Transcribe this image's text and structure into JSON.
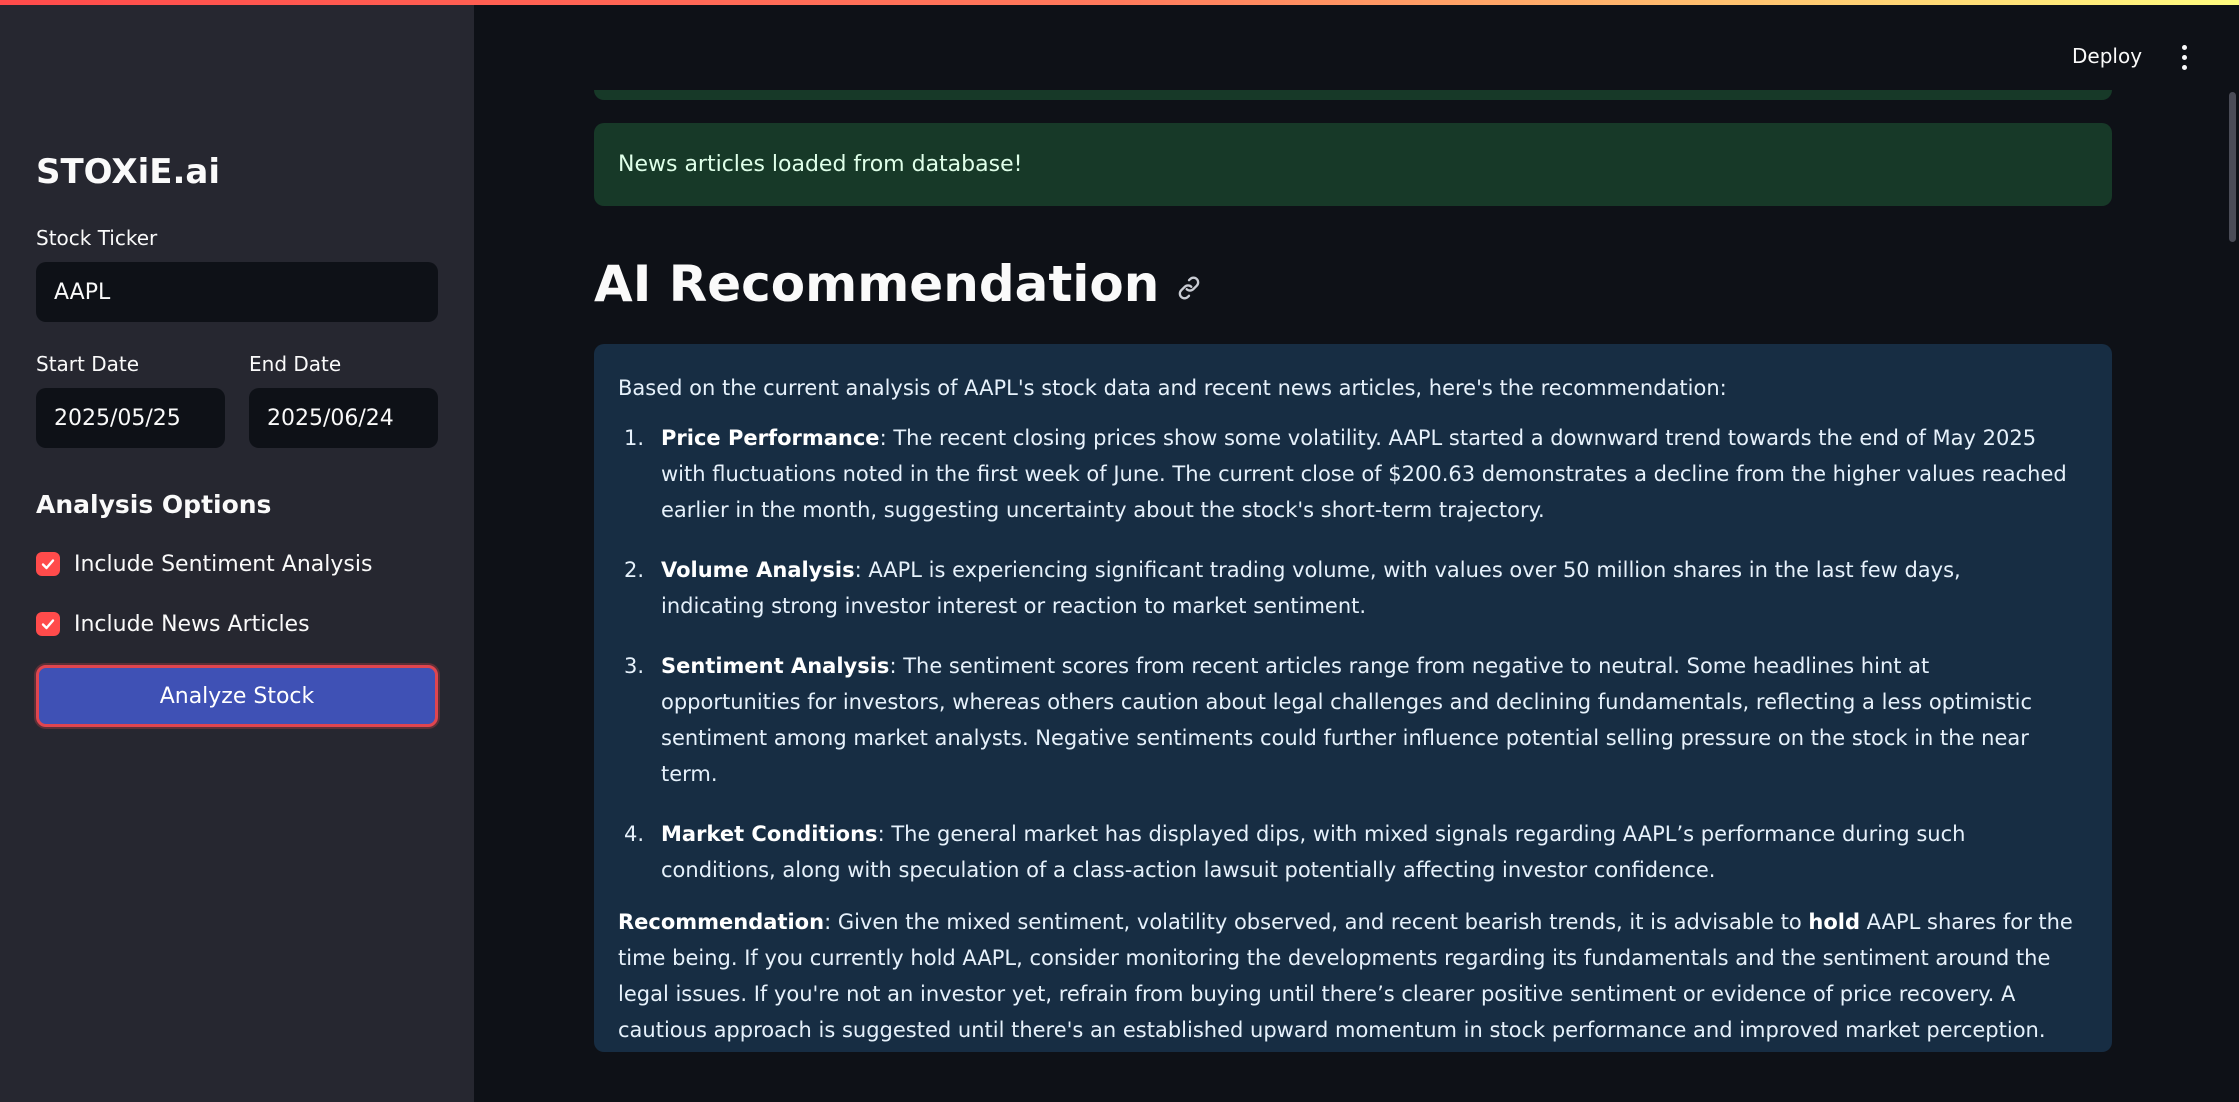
{
  "sidebar": {
    "app_title": "STOXiE.ai",
    "ticker": {
      "label": "Stock Ticker",
      "value": "AAPL"
    },
    "start_date": {
      "label": "Start Date",
      "value": "2025/05/25"
    },
    "end_date": {
      "label": "End Date",
      "value": "2025/06/24"
    },
    "options_heading": "Analysis Options",
    "options": [
      {
        "label": "Include Sentiment Analysis",
        "checked": true
      },
      {
        "label": "Include News Articles",
        "checked": true
      }
    ],
    "analyze_button": "Analyze Stock"
  },
  "header": {
    "deploy_label": "Deploy",
    "menu_icon": "more-vertical-icon"
  },
  "main": {
    "success_message": "News articles loaded from database!",
    "heading": "AI Recommendation",
    "heading_icon": "link-icon",
    "recommendation": {
      "intro": "Based on the current analysis of AAPL's stock data and recent news articles, here's the recommendation:",
      "items": [
        {
          "number": "1.",
          "title": "Price Performance",
          "text": ": The recent closing prices show some volatility. AAPL started a downward trend towards the end of May 2025 with fluctuations noted in the first week of June. The current close of $200.63 demonstrates a decline from the higher values reached earlier in the month, suggesting uncertainty about the stock's short-term trajectory."
        },
        {
          "number": "2.",
          "title": "Volume Analysis",
          "text": ": AAPL is experiencing significant trading volume, with values over 50 million shares in the last few days, indicating strong investor interest or reaction to market sentiment."
        },
        {
          "number": "3.",
          "title": "Sentiment Analysis",
          "text": ": The sentiment scores from recent articles range from negative to neutral. Some headlines hint at opportunities for investors, whereas others caution about legal challenges and declining fundamentals, reflecting a less optimistic sentiment among market analysts. Negative sentiments could further influence potential selling pressure on the stock in the near term."
        },
        {
          "number": "4.",
          "title": "Market Conditions",
          "text": ": The general market has displayed dips, with mixed signals regarding AAPL’s performance during such conditions, along with speculation of a class-action lawsuit potentially affecting investor confidence."
        }
      ],
      "final_label": "Recommendation",
      "final_text_1": ": Given the mixed sentiment, volatility observed, and recent bearish trends, it is advisable to ",
      "final_bold": "hold",
      "final_text_2": " AAPL shares for the time being. If you currently hold AAPL, consider monitoring the developments regarding its fundamentals and the sentiment around the legal issues. If you're not an investor yet, refrain from buying until there’s clearer positive sentiment or evidence of price recovery. A cautious approach is suggested until there's an established upward momentum in stock performance and improved market perception."
    }
  },
  "colors": {
    "accent": "#ff4b4b",
    "button_blue": "#3f51b5",
    "success_bg": "#173928",
    "info_bg": "#172d43",
    "sidebar_bg": "#262730",
    "main_bg": "#0e1117"
  }
}
